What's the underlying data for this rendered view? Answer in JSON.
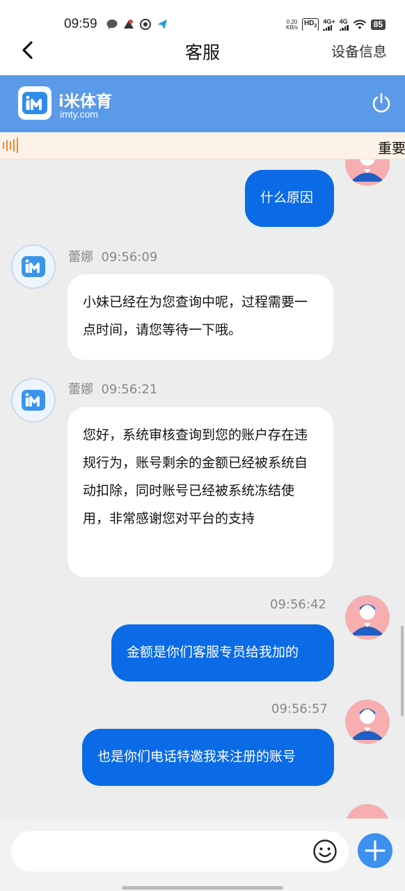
{
  "status_bar": {
    "time": "09:59",
    "net_speed_value": "0.20",
    "net_speed_unit": "KB/s",
    "hd_label": "HD",
    "hd_sub": "2",
    "signal_1": "4G+",
    "signal_2": "4G",
    "battery": "85"
  },
  "nav": {
    "title": "客服",
    "right_label": "设备信息"
  },
  "brand": {
    "name": "i米体育",
    "domain": "imty.com",
    "color": "#5b9ae8"
  },
  "notice": {
    "text": "重要"
  },
  "messages": [
    {
      "sender": "user",
      "text": "什么原因"
    },
    {
      "sender": "agent",
      "name": "蕾娜",
      "time": "09:56:09",
      "text": "小妹已经在为您查询中呢，过程需要一点时间，请您等待一下哦。"
    },
    {
      "sender": "agent",
      "name": "蕾娜",
      "time": "09:56:21",
      "text": "您好，系统审核查询到您的账户存在违规行为，账号剩余的金额已经被系统自动扣除，同时账号已经被系统冻结使用，非常感谢您对平台的支持"
    },
    {
      "sender": "user",
      "time": "09:56:42",
      "text": "金额是你们客服专员给我加的"
    },
    {
      "sender": "user",
      "time": "09:56:57",
      "text": "也是你们电话特邀我来注册的账号"
    }
  ],
  "input": {
    "value": "",
    "placeholder": ""
  },
  "colors": {
    "user_bubble": "#0b6be6",
    "agent_bubble": "#ffffff",
    "chat_background": "#ededed",
    "user_avatar": "#f6aeb1"
  }
}
